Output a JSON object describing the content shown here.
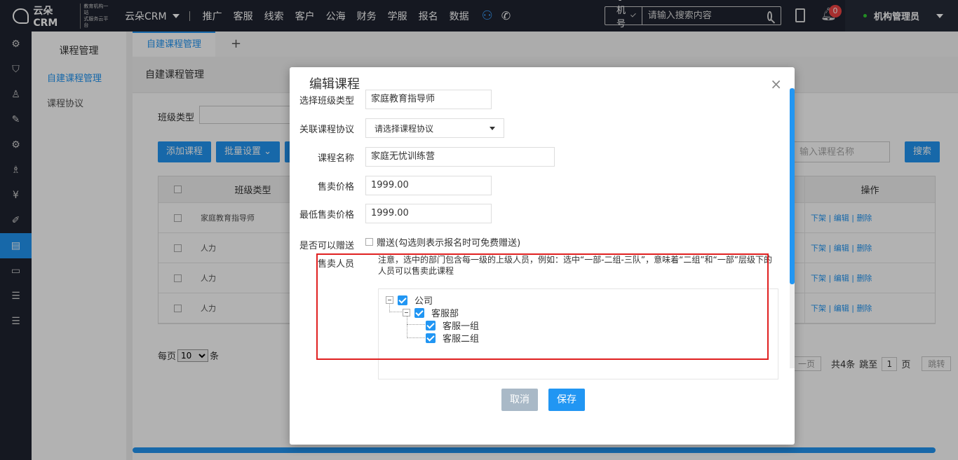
{
  "topbar": {
    "logo_text": "云朵CRM",
    "logo_sub1": "教育机构一站",
    "logo_sub2": "式服务云平台",
    "logo_url": "www.yunduocrm.com",
    "brand": "云朵CRM",
    "nav": [
      "推广",
      "客服",
      "线索",
      "客户",
      "公海",
      "财务",
      "学服",
      "报名",
      "数据"
    ],
    "search_type": "手机号码",
    "search_placeholder": "请输入搜索内容",
    "notification_count": "0",
    "user_name": "机构管理员"
  },
  "sidebar": {
    "icons": [
      "settings-icon",
      "shield-icon",
      "user-icon",
      "pen-icon",
      "gear-icon",
      "team-icon",
      "money-icon",
      "edit-icon",
      "course-icon",
      "card-icon",
      "list-search-icon",
      "list-search-icon-2"
    ],
    "active_index": 8
  },
  "submenu": {
    "title": "课程管理",
    "items": [
      {
        "label": "自建课程管理",
        "active": true
      },
      {
        "label": "课程协议",
        "active": false
      }
    ]
  },
  "tabs": {
    "active": "自建课程管理",
    "add": "+"
  },
  "main": {
    "title": "自建课程管理",
    "filter_label": "班级类型",
    "add_button": "添加课程",
    "batch_button": "批量设置",
    "keyword_placeholder": "输入课程名称",
    "search_button": "搜索",
    "table": {
      "headers": {
        "type": "班级类型",
        "ops": "操作"
      },
      "rows": [
        {
          "type": "家庭教育指导师"
        },
        {
          "type": "人力"
        },
        {
          "type": "人力"
        },
        {
          "type": "人力"
        }
      ],
      "ops": {
        "down": "下架",
        "edit": "编辑",
        "delete": "删除",
        "sep": "|"
      }
    },
    "pager": {
      "per_page_label": "每页",
      "per_page": "10",
      "per_page_unit": "条",
      "prev": "一页",
      "total": "共4条",
      "jump_label": "跳至",
      "page": "1",
      "page_unit": "页",
      "jump_button": "跳转"
    }
  },
  "modal": {
    "title": "编辑课程",
    "fields": {
      "class_type_label": "选择班级类型",
      "class_type_value": "家庭教育指导师",
      "protocol_label": "关联课程协议",
      "protocol_value": "请选择课程协议",
      "name_label": "课程名称",
      "name_value": "家庭无忧训练营",
      "price_label": "售卖价格",
      "price_value": "1999.00",
      "min_price_label": "最低售卖价格",
      "min_price_value": "1999.00",
      "gift_label": "是否可以赠送",
      "gift_text": "赠送(勾选则表示报名时可免费赠送)",
      "seller_label": "售卖人员"
    },
    "note": "注意，选中的部门包含每一级的上级人员，例如：选中“一部-二组-三队”，意味着“二组”和“一部”层级下的人员可以售卖此课程",
    "tree": {
      "root": "公司",
      "dept": "客服部",
      "group1": "客服一组",
      "group2": "客服二组"
    },
    "cancel": "取消",
    "save": "保存",
    "close": "×"
  },
  "colors": {
    "accent": "#2196f3",
    "dark": "#1f2330",
    "highlight": "#e02020"
  }
}
